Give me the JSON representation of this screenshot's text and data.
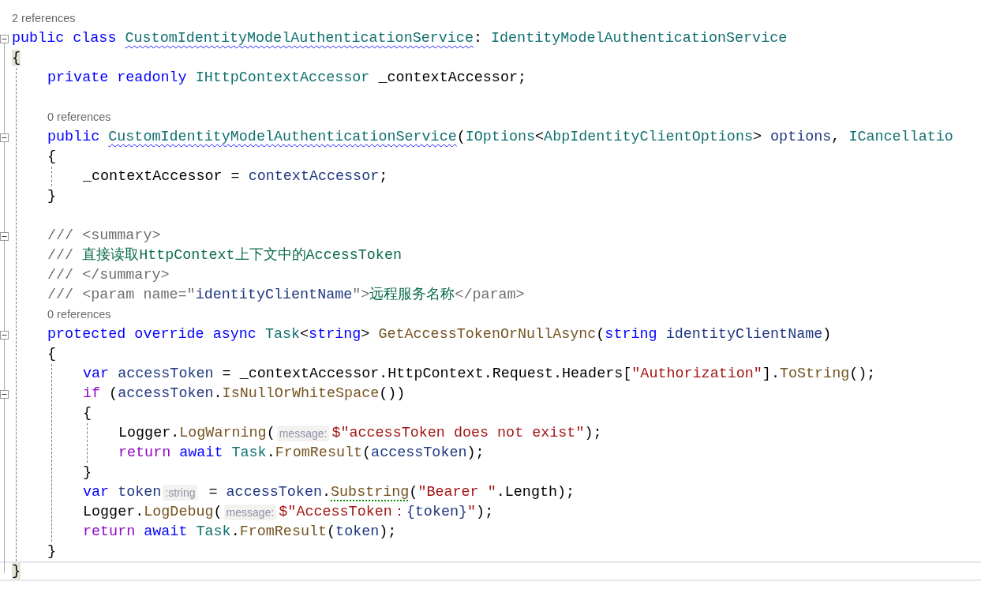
{
  "editor": {
    "lines": [
      {
        "kind": "codelens",
        "text": "2 references"
      },
      {
        "kind": "code",
        "foldable": true,
        "tokens": [
          {
            "kind": "keyword",
            "text": "public class "
          },
          {
            "kind": "type",
            "text": "CustomIdentityModelAuthenticationService",
            "squiggle": true
          },
          {
            "kind": "plain",
            "text": ": "
          },
          {
            "kind": "type",
            "text": "IdentityModelAuthenticationService"
          }
        ]
      },
      {
        "kind": "code",
        "foldable": false,
        "tokens": [
          {
            "kind": "plain",
            "text": "{",
            "brace_match": true
          }
        ],
        "children": [
          {
            "kind": "code",
            "foldable": false,
            "tokens": [
              {
                "kind": "keyword",
                "text": "private readonly "
              },
              {
                "kind": "type",
                "text": "IHttpContextAccessor"
              },
              {
                "kind": "plain",
                "text": " _contextAccessor;"
              }
            ]
          },
          {
            "kind": "blank"
          },
          {
            "kind": "codelens",
            "text": "0 references"
          },
          {
            "kind": "code",
            "foldable": true,
            "tokens": [
              {
                "kind": "keyword",
                "text": "public "
              },
              {
                "kind": "type",
                "text": "CustomIdentityModelAuthenticationService",
                "squiggle": true
              },
              {
                "kind": "plain",
                "text": "("
              },
              {
                "kind": "type",
                "text": "IOptions"
              },
              {
                "kind": "plain",
                "text": "<"
              },
              {
                "kind": "type",
                "text": "AbpIdentityClientOptions"
              },
              {
                "kind": "plain",
                "text": "> "
              },
              {
                "kind": "variable",
                "text": "options"
              },
              {
                "kind": "plain",
                "text": ", "
              },
              {
                "kind": "type",
                "text": "ICancellatio"
              }
            ]
          },
          {
            "kind": "code",
            "foldable": false,
            "tokens": [
              {
                "kind": "plain",
                "text": "{"
              }
            ],
            "children": [
              {
                "kind": "code",
                "foldable": false,
                "tokens": [
                  {
                    "kind": "plain",
                    "text": "_contextAccessor = "
                  },
                  {
                    "kind": "variable",
                    "text": "contextAccessor"
                  },
                  {
                    "kind": "plain",
                    "text": ";"
                  }
                ]
              }
            ]
          },
          {
            "kind": "code",
            "foldable": false,
            "tokens": [
              {
                "kind": "plain",
                "text": "}"
              }
            ]
          },
          {
            "kind": "blank"
          },
          {
            "kind": "code",
            "foldable": true,
            "tokens": [
              {
                "kind": "doc",
                "text": "/// <summary>"
              }
            ]
          },
          {
            "kind": "code",
            "foldable": false,
            "tokens": [
              {
                "kind": "doc",
                "text": "/// "
              },
              {
                "kind": "comment",
                "text": "直接读取HttpContext上下文中的AccessToken"
              }
            ]
          },
          {
            "kind": "code",
            "foldable": false,
            "tokens": [
              {
                "kind": "doc",
                "text": "/// </summary>"
              }
            ]
          },
          {
            "kind": "code",
            "foldable": false,
            "tokens": [
              {
                "kind": "doc",
                "text": "/// <param name=\""
              },
              {
                "kind": "variable",
                "text": "identityClientName"
              },
              {
                "kind": "doc",
                "text": "\">"
              },
              {
                "kind": "comment",
                "text": "远程服务名称"
              },
              {
                "kind": "doc",
                "text": "</param>"
              }
            ]
          },
          {
            "kind": "codelens",
            "text": "0 references"
          },
          {
            "kind": "code",
            "foldable": true,
            "tokens": [
              {
                "kind": "keyword",
                "text": "protected override async "
              },
              {
                "kind": "type",
                "text": "Task"
              },
              {
                "kind": "plain",
                "text": "<"
              },
              {
                "kind": "keyword",
                "text": "string"
              },
              {
                "kind": "plain",
                "text": "> "
              },
              {
                "kind": "method",
                "text": "GetAccessTokenOrNullAsync"
              },
              {
                "kind": "plain",
                "text": "("
              },
              {
                "kind": "keyword",
                "text": "string "
              },
              {
                "kind": "variable",
                "text": "identityClientName"
              },
              {
                "kind": "plain",
                "text": ")"
              }
            ]
          },
          {
            "kind": "code",
            "foldable": false,
            "tokens": [
              {
                "kind": "plain",
                "text": "{"
              }
            ],
            "children": [
              {
                "kind": "code",
                "foldable": false,
                "tokens": [
                  {
                    "kind": "keyword",
                    "text": "var "
                  },
                  {
                    "kind": "variable",
                    "text": "accessToken"
                  },
                  {
                    "kind": "plain",
                    "text": " = _contextAccessor.HttpContext.Request.Headers["
                  },
                  {
                    "kind": "string",
                    "text": "\"Authorization\""
                  },
                  {
                    "kind": "plain",
                    "text": "]."
                  },
                  {
                    "kind": "method",
                    "text": "ToString"
                  },
                  {
                    "kind": "plain",
                    "text": "();"
                  }
                ]
              },
              {
                "kind": "code",
                "foldable": true,
                "tokens": [
                  {
                    "kind": "control",
                    "text": "if "
                  },
                  {
                    "kind": "plain",
                    "text": "("
                  },
                  {
                    "kind": "variable",
                    "text": "accessToken"
                  },
                  {
                    "kind": "plain",
                    "text": "."
                  },
                  {
                    "kind": "method",
                    "text": "IsNullOrWhiteSpace"
                  },
                  {
                    "kind": "plain",
                    "text": "())"
                  }
                ]
              },
              {
                "kind": "code",
                "foldable": false,
                "tokens": [
                  {
                    "kind": "plain",
                    "text": "{"
                  }
                ],
                "children": [
                  {
                    "kind": "code",
                    "foldable": false,
                    "tokens": [
                      {
                        "kind": "plain",
                        "text": "Logger."
                      },
                      {
                        "kind": "method",
                        "text": "LogWarning"
                      },
                      {
                        "kind": "plain",
                        "text": "("
                      },
                      {
                        "kind": "hint",
                        "text": "message:"
                      },
                      {
                        "kind": "string",
                        "text": "$\"accessToken does not exist\""
                      },
                      {
                        "kind": "plain",
                        "text": ");"
                      }
                    ]
                  },
                  {
                    "kind": "code",
                    "foldable": false,
                    "tokens": [
                      {
                        "kind": "control",
                        "text": "return "
                      },
                      {
                        "kind": "keyword",
                        "text": "await "
                      },
                      {
                        "kind": "type",
                        "text": "Task"
                      },
                      {
                        "kind": "plain",
                        "text": "."
                      },
                      {
                        "kind": "method",
                        "text": "FromResult"
                      },
                      {
                        "kind": "plain",
                        "text": "("
                      },
                      {
                        "kind": "variable",
                        "text": "accessToken"
                      },
                      {
                        "kind": "plain",
                        "text": ");"
                      }
                    ]
                  }
                ]
              },
              {
                "kind": "code",
                "foldable": false,
                "tokens": [
                  {
                    "kind": "plain",
                    "text": "}"
                  }
                ]
              },
              {
                "kind": "code",
                "foldable": false,
                "tokens": [
                  {
                    "kind": "keyword",
                    "text": "var "
                  },
                  {
                    "kind": "variable",
                    "text": "token"
                  },
                  {
                    "kind": "hint",
                    "text": ":string"
                  },
                  {
                    "kind": "plain",
                    "text": " = "
                  },
                  {
                    "kind": "variable",
                    "text": "accessToken"
                  },
                  {
                    "kind": "plain",
                    "text": "."
                  },
                  {
                    "kind": "method",
                    "text": "Substring",
                    "dotted": true
                  },
                  {
                    "kind": "plain",
                    "text": "("
                  },
                  {
                    "kind": "string",
                    "text": "\"Bearer \""
                  },
                  {
                    "kind": "plain",
                    "text": ".Length);"
                  }
                ]
              },
              {
                "kind": "code",
                "foldable": false,
                "tokens": [
                  {
                    "kind": "plain",
                    "text": "Logger."
                  },
                  {
                    "kind": "method",
                    "text": "LogDebug"
                  },
                  {
                    "kind": "plain",
                    "text": "("
                  },
                  {
                    "kind": "hint",
                    "text": "message:"
                  },
                  {
                    "kind": "string",
                    "text": "$\"AccessToken："
                  },
                  {
                    "kind": "variable",
                    "text": "{token}"
                  },
                  {
                    "kind": "string",
                    "text": "\""
                  },
                  {
                    "kind": "plain",
                    "text": ");"
                  }
                ]
              },
              {
                "kind": "code",
                "foldable": false,
                "tokens": [
                  {
                    "kind": "control",
                    "text": "return "
                  },
                  {
                    "kind": "keyword",
                    "text": "await "
                  },
                  {
                    "kind": "type",
                    "text": "Task"
                  },
                  {
                    "kind": "plain",
                    "text": "."
                  },
                  {
                    "kind": "method",
                    "text": "FromResult"
                  },
                  {
                    "kind": "plain",
                    "text": "("
                  },
                  {
                    "kind": "variable",
                    "text": "token"
                  },
                  {
                    "kind": "plain",
                    "text": ");"
                  }
                ]
              }
            ]
          },
          {
            "kind": "code",
            "foldable": false,
            "tokens": [
              {
                "kind": "plain",
                "text": "}"
              }
            ]
          }
        ]
      },
      {
        "kind": "code",
        "foldable": false,
        "current": true,
        "tokens": [
          {
            "kind": "plain",
            "text": "}",
            "brace_match": true
          }
        ]
      }
    ]
  }
}
